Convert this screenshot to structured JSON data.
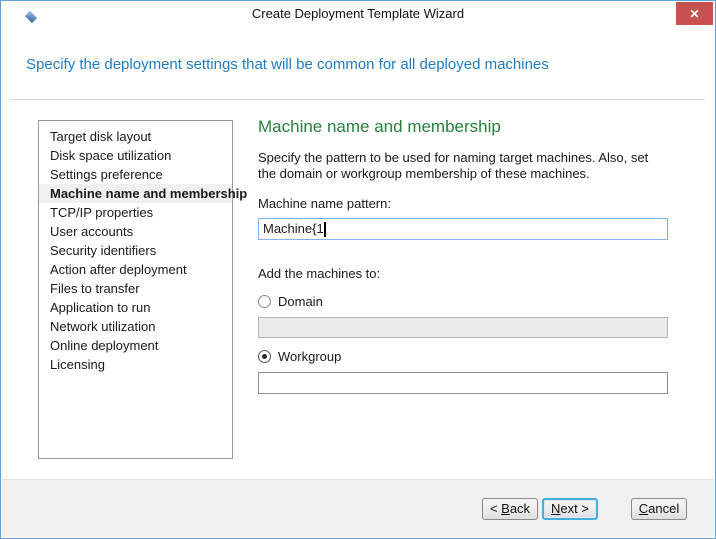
{
  "window": {
    "title": "Create Deployment Template Wizard",
    "close_glyph": "✕"
  },
  "header": {
    "instruction": "Specify the deployment settings that will be common for all deployed machines"
  },
  "sidebar": {
    "items": [
      {
        "label": "Target disk layout",
        "selected": false
      },
      {
        "label": "Disk space utilization",
        "selected": false
      },
      {
        "label": "Settings preference",
        "selected": false
      },
      {
        "label": "Machine name and membership",
        "selected": true
      },
      {
        "label": "TCP/IP properties",
        "selected": false
      },
      {
        "label": "User accounts",
        "selected": false
      },
      {
        "label": "Security identifiers",
        "selected": false
      },
      {
        "label": "Action after deployment",
        "selected": false
      },
      {
        "label": "Files to transfer",
        "selected": false
      },
      {
        "label": "Application to run",
        "selected": false
      },
      {
        "label": "Network utilization",
        "selected": false
      },
      {
        "label": "Online deployment",
        "selected": false
      },
      {
        "label": "Licensing",
        "selected": false
      }
    ]
  },
  "content": {
    "heading": "Machine name and membership",
    "description": "Specify the pattern to be used for naming target machines. Also, set the domain or workgroup membership of these machines.",
    "machine_name": {
      "label": "Machine name pattern:",
      "value": "Machine{1",
      "caret_visible": true
    },
    "membership": {
      "label": "Add the machines to:",
      "domain": {
        "label": "Domain",
        "selected": false,
        "input_value": "",
        "input_enabled": false
      },
      "workgroup": {
        "label": "Workgroup",
        "selected": true,
        "input_value": "",
        "input_enabled": true
      }
    }
  },
  "footer": {
    "back": {
      "pre": "< ",
      "mnemonic": "B",
      "rest": "ack"
    },
    "next": {
      "pre": "",
      "mnemonic": "N",
      "rest": "ext >"
    },
    "cancel": {
      "pre": "",
      "mnemonic": "C",
      "rest": "ancel"
    }
  },
  "colors": {
    "window_border": "#62a1d8",
    "close_button_red": "#c75050",
    "instruction_blue": "#1f7dc2",
    "heading_green": "#28803c",
    "selected_item_bg": "#f0f0f0",
    "focus_input_border": "#7eb4ea",
    "disabled_input_bg": "#ebebeb",
    "footer_bg": "#f0f0f0",
    "next_button_focus_border": "#46aede"
  }
}
